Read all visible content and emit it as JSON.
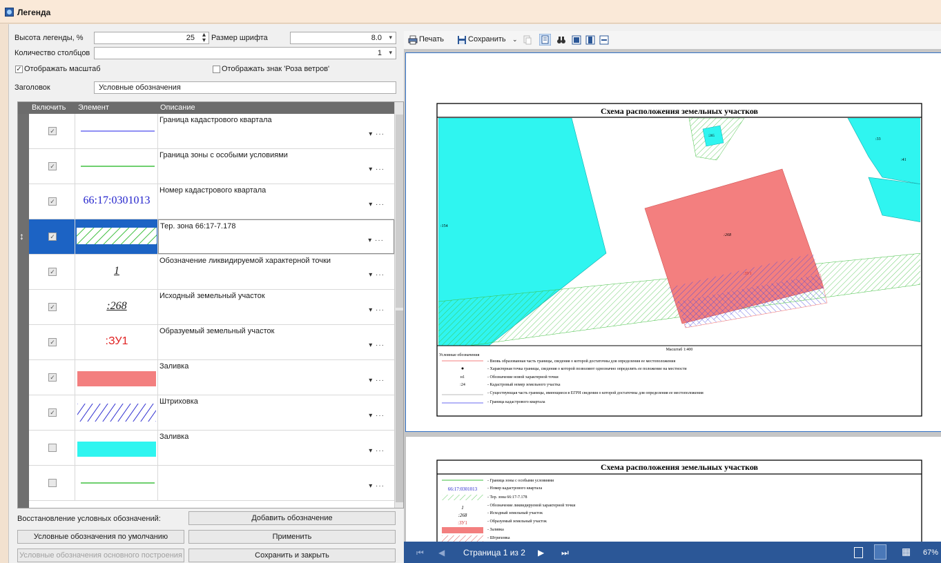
{
  "window": {
    "title": "Легенда"
  },
  "form": {
    "legend_height_label": "Высота легенды, %",
    "legend_height_value": "25",
    "font_size_label": "Размер шрифта",
    "font_size_value": "8.0",
    "columns_label": "Количество столбцов",
    "columns_value": "1",
    "show_scale_label": "Отображать масштаб",
    "show_windrose_label": "Отображать знак 'Роза ветров'",
    "heading_label": "Заголовок",
    "heading_value": "Условные обозначения"
  },
  "grid": {
    "columns": [
      "Включить",
      "Элемент",
      "Описание"
    ],
    "rows": [
      {
        "checked": true,
        "element": "line-blue",
        "desc": "Граница кадастрового квартала"
      },
      {
        "checked": true,
        "element": "line-green",
        "desc": "Граница зоны с особыми условиями"
      },
      {
        "checked": true,
        "element": "text",
        "element_text": "66:17:0301013",
        "desc": "Номер кадастрового квартала"
      },
      {
        "checked": true,
        "element": "hatch-green",
        "desc": "Тер. зона 66:17-7.178"
      },
      {
        "checked": true,
        "element": "text",
        "element_text": "1",
        "desc": "Обозначение ликвидируемой характерной точки"
      },
      {
        "checked": true,
        "element": "text",
        "element_text": ":268",
        "desc": "Исходный земельный участок"
      },
      {
        "checked": true,
        "element": "text",
        "element_text": ":ЗУ1",
        "desc": "Образуемый земельный участок"
      },
      {
        "checked": true,
        "element": "fill-red",
        "desc": "Заливка"
      },
      {
        "checked": true,
        "element": "hatch-blue",
        "desc": "Штриховка"
      },
      {
        "checked": false,
        "element": "fill-cyan",
        "desc": "Заливка"
      },
      {
        "checked": false,
        "element": "line-green",
        "desc": ""
      }
    ],
    "more_glyph": "▾ ···"
  },
  "buttons": {
    "restore_label": "Восстановление условных обозначений:",
    "add": "Добавить обозначение",
    "defaults": "Условные обозначения по умолчанию",
    "apply": "Применить",
    "main_build": "Условные обозначения основного построения",
    "save_close": "Сохранить и закрыть"
  },
  "toolbar": {
    "print": "Печать",
    "save": "Сохранить"
  },
  "preview": {
    "map_title": "Схема расположения земельных участков",
    "scale": "Масштаб 1:400",
    "legend_heading": "Условные обозначения",
    "labels": {
      "p154": ":154",
      "p268": ":268",
      "zu1": ":ЗУ1",
      "p33": ":33",
      "p41": ":41",
      "p265": ":265"
    },
    "legend1": [
      "- Вновь образованная часть границы, сведения о которой достаточны для определения ее местоположения",
      "- Характерная точка границы, сведения о которой позволяют однозначно определить ее положение на местности",
      "- Обозначение новой характерной точки",
      "- Кадастровый номер земельного участка",
      "- Существующая часть границы, имеющиеся в ЕГРН сведения о которой достаточны для определения ее местоположения",
      "- Граница кадастрового квартала"
    ],
    "legend1_symbols": {
      "n1": "н1",
      "p24": ":24"
    },
    "legend2": [
      "- Граница зоны с особыми условиями",
      "- Номер кадастрового квартала",
      "- Тер. зона 66:17-7.178",
      "- Обозначение ликвидируемой характерной точки",
      "- Исходный земельный участок",
      "- Образуемый земельный участок",
      "- Заливка",
      "- Штриховка"
    ],
    "legend2_symbols": {
      "kvartal": "66:17:0301013",
      "one": "1",
      "p268": ":268",
      "zu1": ":ЗУ1"
    }
  },
  "status": {
    "page": "Страница 1 из 2",
    "zoom": "67%"
  },
  "colors": {
    "accent": "#2b5797",
    "selected": "#1c63c4",
    "cyan": "#2ff5f0",
    "red": "#f37f7f"
  }
}
